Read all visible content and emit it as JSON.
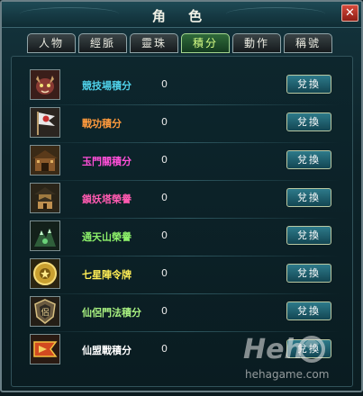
{
  "window": {
    "title": "角 色",
    "close_label": "✕"
  },
  "tabs": [
    {
      "label": "人物",
      "active": false
    },
    {
      "label": "經脈",
      "active": false
    },
    {
      "label": "靈珠",
      "active": false
    },
    {
      "label": "積分",
      "active": true
    },
    {
      "label": "動作",
      "active": false
    },
    {
      "label": "稱號",
      "active": false
    }
  ],
  "rows": [
    {
      "name": "競技場積分",
      "value": "0",
      "button": "兌換",
      "color": "#4fd0e8",
      "icon": "beast-mask-icon"
    },
    {
      "name": "戰功積分",
      "value": "0",
      "button": "兌換",
      "color": "#ff9a3c",
      "icon": "war-banner-icon"
    },
    {
      "name": "玉門關積分",
      "value": "0",
      "button": "兌換",
      "color": "#ff4fd8",
      "icon": "fortress-gate-icon"
    },
    {
      "name": "鎖妖塔榮譽",
      "value": "0",
      "button": "兌換",
      "color": "#ff5ab0",
      "icon": "pagoda-icon"
    },
    {
      "name": "通天山榮譽",
      "value": "0",
      "button": "兌換",
      "color": "#8cf06a",
      "icon": "mountain-spirit-icon"
    },
    {
      "name": "七星陣令牌",
      "value": "0",
      "button": "兌換",
      "color": "#ffee55",
      "icon": "seven-star-token-icon"
    },
    {
      "name": "仙侶門法積分",
      "value": "0",
      "button": "兌換",
      "color": "#a8f080",
      "icon": "shield-emblem-icon"
    },
    {
      "name": "仙盟戰積分",
      "value": "0",
      "button": "兌換",
      "color": "#ffffff",
      "icon": "alliance-flag-icon"
    }
  ],
  "watermark": {
    "brand": "Heh",
    "site": "hehagame.com"
  }
}
